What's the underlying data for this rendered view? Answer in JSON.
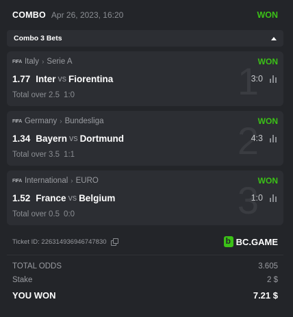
{
  "header": {
    "title": "COMBO",
    "date": "Apr 26, 2023, 16:20",
    "status": "WON"
  },
  "bets_toggle": {
    "label": "Combo 3 Bets"
  },
  "legs": [
    {
      "index": "1",
      "sport_tag": "FIFA",
      "country": "Italy",
      "league": "Serie A",
      "status": "WON",
      "odds": "1.77",
      "home": "Inter",
      "vs": "vs",
      "away": "Fiorentina",
      "score": "3:0",
      "market": "Total over 2.5",
      "result": "1:0"
    },
    {
      "index": "2",
      "sport_tag": "FIFA",
      "country": "Germany",
      "league": "Bundesliga",
      "status": "WON",
      "odds": "1.34",
      "home": "Bayern",
      "vs": "vs",
      "away": "Dortmund",
      "score": "4:3",
      "market": "Total over 3.5",
      "result": "1:1"
    },
    {
      "index": "3",
      "sport_tag": "FIFA",
      "country": "International",
      "league": "EURO",
      "status": "WON",
      "odds": "1.52",
      "home": "France",
      "vs": "vs",
      "away": "Belgium",
      "score": "1:0",
      "market": "Total over 0.5",
      "result": "0:0"
    }
  ],
  "ticket": {
    "label": "Ticket ID:",
    "id": "226314936946747830"
  },
  "brand": {
    "name": "BC.GAME"
  },
  "summary": {
    "total_odds_label": "TOTAL ODDS",
    "total_odds": "3.605",
    "stake_label": "Stake",
    "stake": "2 $",
    "won_label": "YOU WON",
    "won": "7.21 $"
  },
  "colors": {
    "accent": "#3bc117",
    "background": "#232529",
    "panel": "#2c2e33"
  }
}
